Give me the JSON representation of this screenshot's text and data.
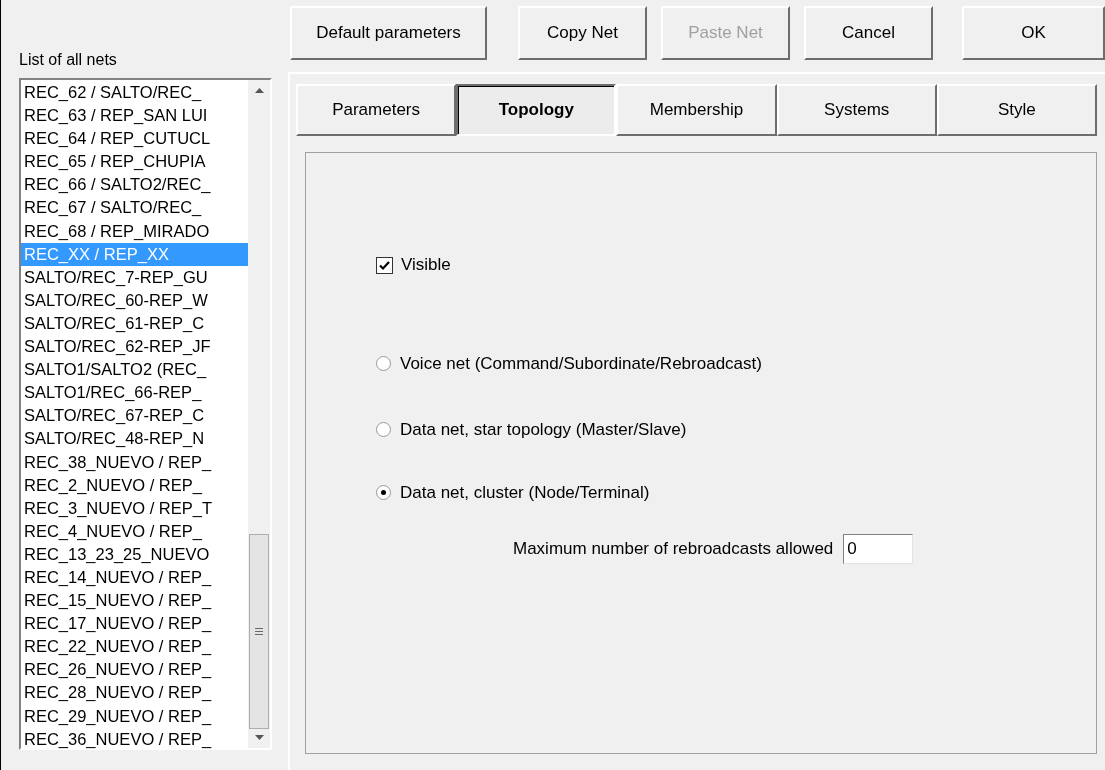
{
  "nets_list": {
    "label": "List of all nets",
    "items": [
      {
        "label": "REC_62 / SALTO/REC_",
        "selected": false
      },
      {
        "label": "REC_63 / REP_SAN LUI",
        "selected": false
      },
      {
        "label": "REC_64 / REP_CUTUCL",
        "selected": false
      },
      {
        "label": "REC_65 / REP_CHUPIA",
        "selected": false
      },
      {
        "label": "REC_66 / SALTO2/REC_",
        "selected": false
      },
      {
        "label": "REC_67 / SALTO/REC_",
        "selected": false
      },
      {
        "label": "REC_68 / REP_MIRADO",
        "selected": false
      },
      {
        "label": "REC_XX / REP_XX",
        "selected": true
      },
      {
        "label": "SALTO/REC_7-REP_GU",
        "selected": false
      },
      {
        "label": "SALTO/REC_60-REP_W",
        "selected": false
      },
      {
        "label": "SALTO/REC_61-REP_C",
        "selected": false
      },
      {
        "label": "SALTO/REC_62-REP_JF",
        "selected": false
      },
      {
        "label": "SALTO1/SALTO2 (REC_",
        "selected": false
      },
      {
        "label": "SALTO1/REC_66-REP_",
        "selected": false
      },
      {
        "label": "SALTO/REC_67-REP_C",
        "selected": false
      },
      {
        "label": "SALTO/REC_48-REP_N",
        "selected": false
      },
      {
        "label": "REC_38_NUEVO / REP_",
        "selected": false
      },
      {
        "label": "REC_2_NUEVO / REP_",
        "selected": false
      },
      {
        "label": "REC_3_NUEVO / REP_T",
        "selected": false
      },
      {
        "label": "REC_4_NUEVO / REP_",
        "selected": false
      },
      {
        "label": "REC_13_23_25_NUEVO",
        "selected": false
      },
      {
        "label": "REC_14_NUEVO / REP_",
        "selected": false
      },
      {
        "label": "REC_15_NUEVO / REP_",
        "selected": false
      },
      {
        "label": "REC_17_NUEVO / REP_",
        "selected": false
      },
      {
        "label": "REC_22_NUEVO / REP_",
        "selected": false
      },
      {
        "label": "REC_26_NUEVO / REP_",
        "selected": false
      },
      {
        "label": "REC_28_NUEVO / REP_",
        "selected": false
      },
      {
        "label": "REC_29_NUEVO / REP_",
        "selected": false
      },
      {
        "label": "REC_36_NUEVO / REP_",
        "selected": false
      }
    ]
  },
  "buttons": [
    {
      "label": "Default parameters",
      "disabled": false
    },
    {
      "label": "Copy Net",
      "disabled": false
    },
    {
      "label": "Paste Net",
      "disabled": true
    },
    {
      "label": "Cancel",
      "disabled": false
    },
    {
      "label": "OK",
      "disabled": false
    }
  ],
  "tabs": [
    {
      "label": "Parameters",
      "selected": false
    },
    {
      "label": "Topology",
      "selected": true
    },
    {
      "label": "Membership",
      "selected": false
    },
    {
      "label": "Systems",
      "selected": false
    },
    {
      "label": "Style",
      "selected": false
    }
  ],
  "topology": {
    "visible": {
      "label": "Visible",
      "checked": true
    },
    "net_types": [
      {
        "label": "Voice net (Command/Subordinate/Rebroadcast)",
        "selected": false
      },
      {
        "label": "Data net, star topology (Master/Slave)",
        "selected": false
      },
      {
        "label": "Data net, cluster (Node/Terminal)",
        "selected": true
      }
    ],
    "max_rebroadcasts": {
      "label": "Maximum number of rebroadcasts allowed",
      "value": "0"
    }
  }
}
